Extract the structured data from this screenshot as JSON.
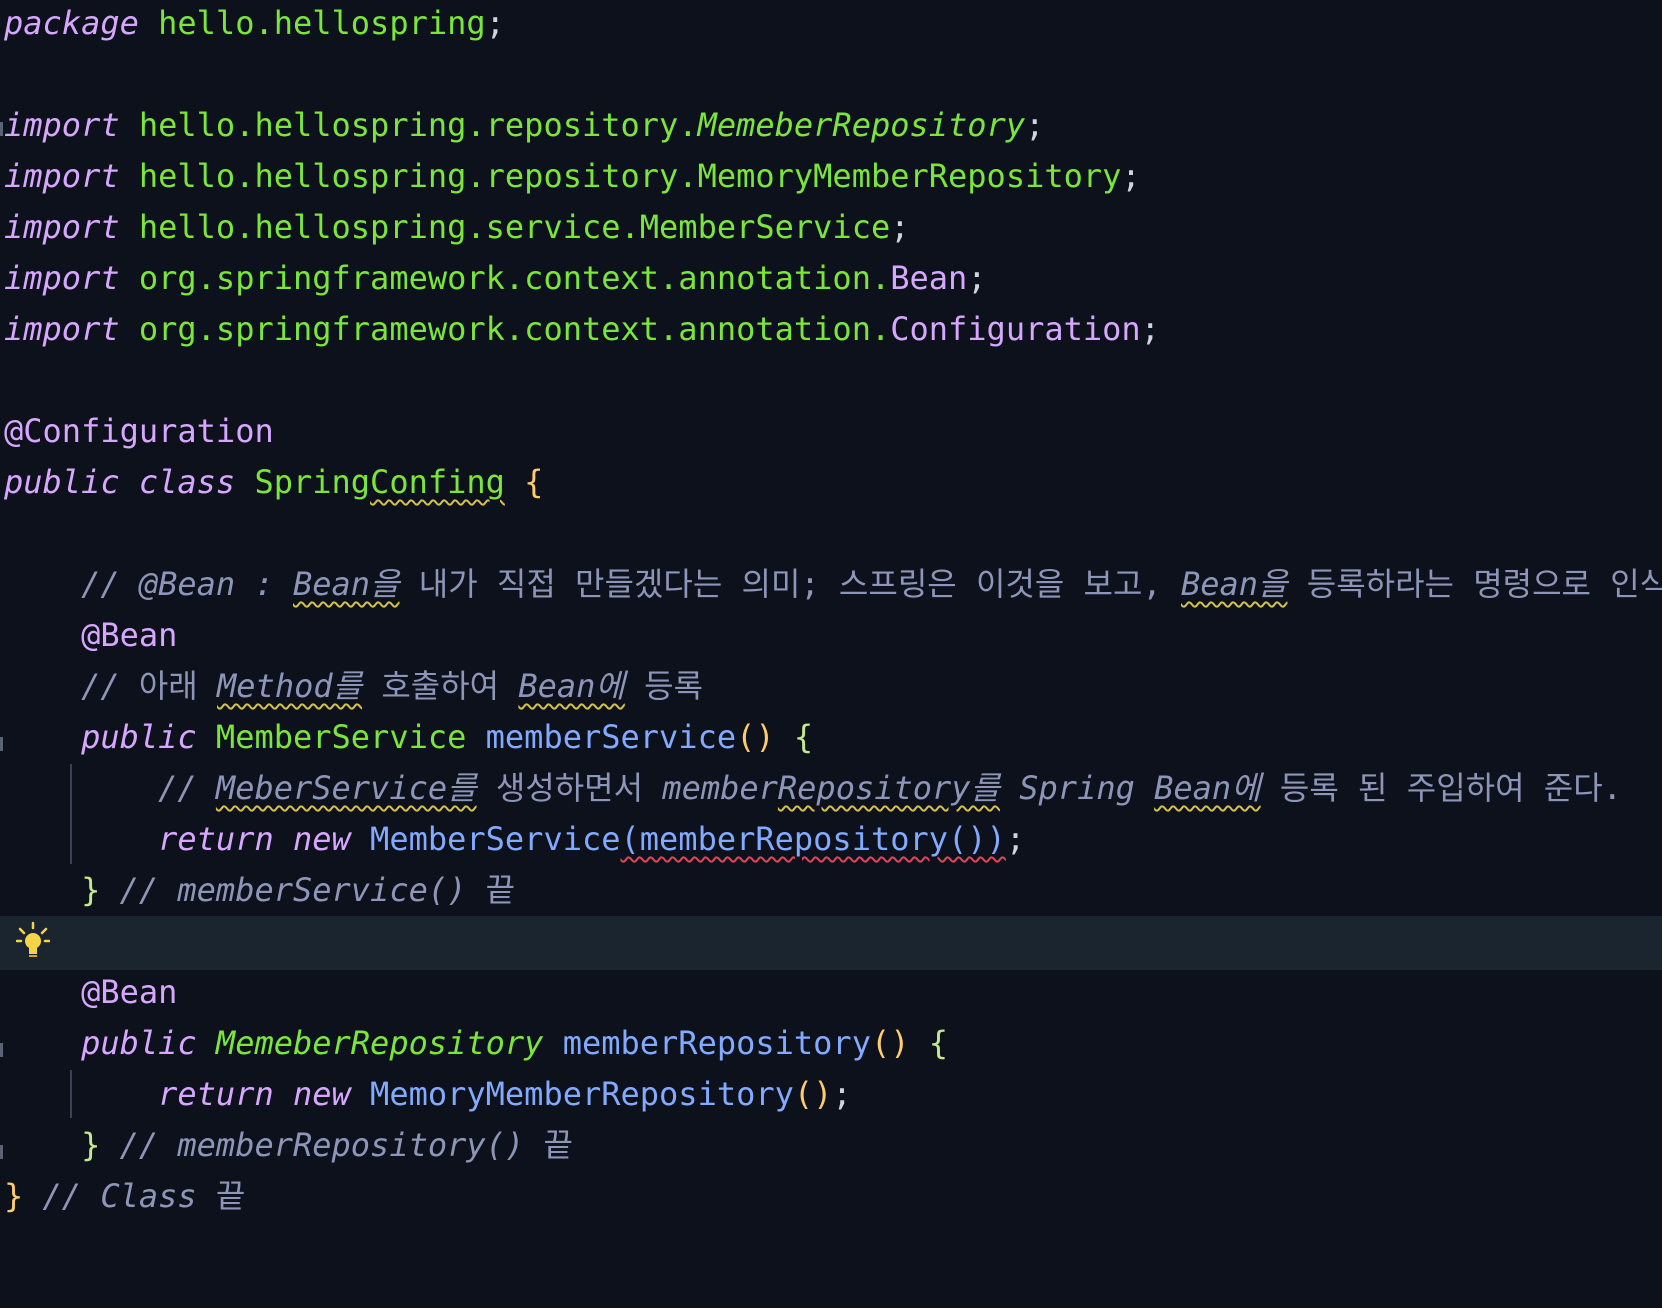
{
  "editor": {
    "highlight_line_index": 17,
    "lines": [
      {
        "tokens": [
          [
            "kw",
            "package"
          ],
          [
            "punct",
            " "
          ],
          [
            "pkg",
            "hello.hellospring"
          ],
          [
            "punct",
            ";"
          ]
        ]
      },
      {
        "tokens": []
      },
      {
        "tokens": [
          [
            "kw",
            "import"
          ],
          [
            "punct",
            " "
          ],
          [
            "pkg",
            "hello.hellospring.repository."
          ],
          [
            "type-it",
            "MemeberRepository"
          ],
          [
            "punct",
            ";"
          ]
        ]
      },
      {
        "tokens": [
          [
            "kw",
            "import"
          ],
          [
            "punct",
            " "
          ],
          [
            "pkg",
            "hello.hellospring.repository.MemoryMemberRepository"
          ],
          [
            "punct",
            ";"
          ]
        ]
      },
      {
        "tokens": [
          [
            "kw",
            "import"
          ],
          [
            "punct",
            " "
          ],
          [
            "pkg",
            "hello.hellospring.service.MemberService"
          ],
          [
            "punct",
            ";"
          ]
        ]
      },
      {
        "tokens": [
          [
            "kw",
            "import"
          ],
          [
            "punct",
            " "
          ],
          [
            "pkg",
            "org.springframework.context.annotation."
          ],
          [
            "anno-cls",
            "Bean"
          ],
          [
            "punct",
            ";"
          ]
        ]
      },
      {
        "tokens": [
          [
            "kw",
            "import"
          ],
          [
            "punct",
            " "
          ],
          [
            "pkg",
            "org.springframework.context.annotation."
          ],
          [
            "anno-cls",
            "Configuration"
          ],
          [
            "punct",
            ";"
          ]
        ]
      },
      {
        "tokens": []
      },
      {
        "tokens": [
          [
            "anno",
            "@Configuration"
          ]
        ]
      },
      {
        "tokens": [
          [
            "kw",
            "public"
          ],
          [
            "punct",
            " "
          ],
          [
            "kw",
            "class"
          ],
          [
            "punct",
            " "
          ],
          [
            "type",
            "Spring"
          ],
          [
            "type squiggle-y",
            "Confing"
          ],
          [
            "punct",
            " "
          ],
          [
            "brace",
            "{"
          ]
        ]
      },
      {
        "tokens": []
      },
      {
        "tokens": [
          [
            "punct",
            "    "
          ],
          [
            "cmt",
            "// @Bean : "
          ],
          [
            "cmt squiggle-y",
            "Bean을"
          ],
          [
            "cmt-ko",
            " 내가 직접 만들겠다는 의미; 스프링은 이것을 보고, "
          ],
          [
            "cmt squiggle-y",
            "Bean을"
          ],
          [
            "cmt-ko",
            " 등록하라는 명령으로 인식"
          ]
        ]
      },
      {
        "tokens": [
          [
            "punct",
            "    "
          ],
          [
            "anno",
            "@Bean"
          ]
        ]
      },
      {
        "tokens": [
          [
            "punct",
            "    "
          ],
          [
            "cmt",
            "// "
          ],
          [
            "cmt-ko",
            "아래 "
          ],
          [
            "cmt squiggle-y",
            "Method를"
          ],
          [
            "cmt-ko",
            " 호출하여 "
          ],
          [
            "cmt squiggle-y",
            "Bean에"
          ],
          [
            "cmt-ko",
            " 등록"
          ]
        ]
      },
      {
        "tokens": [
          [
            "punct",
            "    "
          ],
          [
            "kw",
            "public"
          ],
          [
            "punct",
            " "
          ],
          [
            "type",
            "MemberService"
          ],
          [
            "punct",
            " "
          ],
          [
            "fn",
            "memberService"
          ],
          [
            "brace",
            "()"
          ],
          [
            "punct",
            " "
          ],
          [
            "brace2",
            "{"
          ]
        ]
      },
      {
        "tokens": [
          [
            "punct",
            "        "
          ],
          [
            "cmt",
            "// "
          ],
          [
            "cmt squiggle-y",
            "MeberService를"
          ],
          [
            "cmt-ko",
            " 생성하면서 "
          ],
          [
            "cmt",
            "member"
          ],
          [
            "cmt squiggle-y",
            "Repository를"
          ],
          [
            "cmt",
            " Spring "
          ],
          [
            "cmt squiggle-y",
            "Bean에"
          ],
          [
            "cmt-ko",
            " 등록 된 주입하여 준다."
          ]
        ]
      },
      {
        "tokens": [
          [
            "punct",
            "        "
          ],
          [
            "kw",
            "return"
          ],
          [
            "punct",
            " "
          ],
          [
            "kw",
            "new"
          ],
          [
            "punct",
            " "
          ],
          [
            "cls-call",
            "MemberService"
          ],
          [
            "fn squiggle-r",
            "(memberRepository())"
          ],
          [
            "punct",
            ";"
          ]
        ]
      },
      {
        "tokens": [
          [
            "punct",
            "    "
          ],
          [
            "brace2",
            "}"
          ],
          [
            "punct",
            " "
          ],
          [
            "cmt",
            "// memberService() "
          ],
          [
            "cmt-ko",
            "끝"
          ]
        ]
      },
      {
        "tokens": []
      },
      {
        "tokens": [
          [
            "punct",
            "    "
          ],
          [
            "anno",
            "@Bean"
          ]
        ]
      },
      {
        "tokens": [
          [
            "punct",
            "    "
          ],
          [
            "kw",
            "public"
          ],
          [
            "punct",
            " "
          ],
          [
            "type-it",
            "MemeberRepository"
          ],
          [
            "punct",
            " "
          ],
          [
            "fn",
            "memberRepository"
          ],
          [
            "brace",
            "()"
          ],
          [
            "punct",
            " "
          ],
          [
            "brace2",
            "{"
          ]
        ]
      },
      {
        "tokens": [
          [
            "punct",
            "        "
          ],
          [
            "kw",
            "return"
          ],
          [
            "punct",
            " "
          ],
          [
            "kw",
            "new"
          ],
          [
            "punct",
            " "
          ],
          [
            "cls-call",
            "MemoryMemberRepository"
          ],
          [
            "brace",
            "()"
          ],
          [
            "punct",
            ";"
          ]
        ]
      },
      {
        "tokens": [
          [
            "punct",
            "    "
          ],
          [
            "brace2",
            "}"
          ],
          [
            "punct",
            " "
          ],
          [
            "cmt",
            "// memberRepository() "
          ],
          [
            "cmt-ko",
            "끝"
          ]
        ]
      },
      {
        "tokens": [
          [
            "brace",
            "}"
          ],
          [
            "punct",
            " "
          ],
          [
            "cmt",
            "// Class "
          ],
          [
            "cmt-ko",
            "끝"
          ]
        ]
      }
    ]
  },
  "intention_icon": "lightbulb-icon"
}
